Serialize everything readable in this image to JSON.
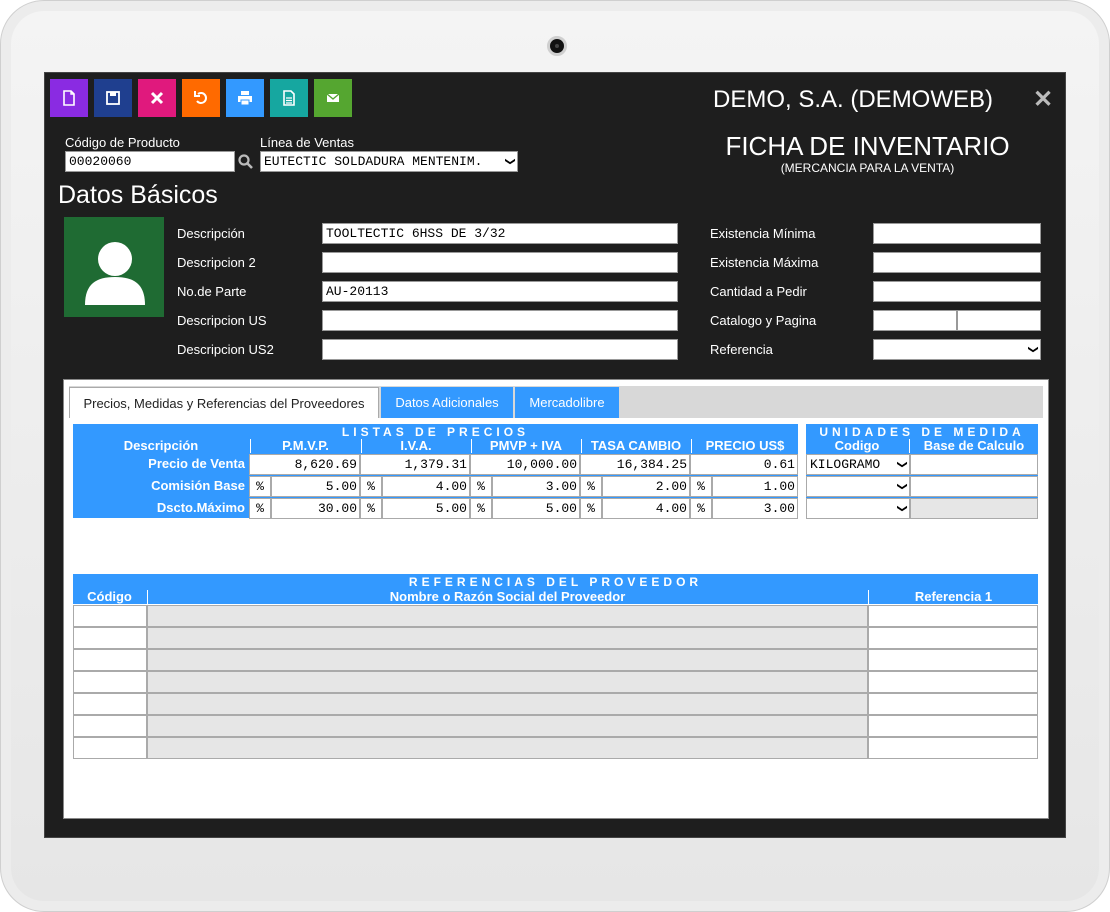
{
  "window": {
    "company": "DEMO, S.A. (DEMOWEB)",
    "title": "FICHA DE INVENTARIO",
    "subtitle": "(MERCANCIA PARA LA VENTA)"
  },
  "toolbar": [
    {
      "name": "new-button",
      "icon": "new-document-icon",
      "color": "#8a2be2"
    },
    {
      "name": "save-button",
      "icon": "floppy-disk-icon",
      "color": "#1f3f8f"
    },
    {
      "name": "delete-button",
      "icon": "x-icon",
      "color": "#e0197d"
    },
    {
      "name": "undo-button",
      "icon": "undo-icon",
      "color": "#ff6a00"
    },
    {
      "name": "print-button",
      "icon": "printer-icon",
      "color": "#3399ff"
    },
    {
      "name": "report-button",
      "icon": "document-icon",
      "color": "#16a7a0"
    },
    {
      "name": "email-button",
      "icon": "envelope-icon",
      "color": "#55a630"
    }
  ],
  "header": {
    "codigo_label": "Código de Producto",
    "codigo_value": "00020060",
    "linea_label": "Línea de Ventas",
    "linea_value": "EUTECTIC SOLDADURA MENTENIM."
  },
  "section_title": "Datos Básicos",
  "basic_fields_left": [
    {
      "label": "Descripción",
      "value": "TOOLTECTIC 6HSS DE 3/32"
    },
    {
      "label": "Descripcion 2",
      "value": ""
    },
    {
      "label": "No.de Parte",
      "value": "AU-20113"
    },
    {
      "label": "Descripcion US",
      "value": ""
    },
    {
      "label": "Descripcion US2",
      "value": ""
    }
  ],
  "basic_fields_right": [
    {
      "label": "Existencia Mínima",
      "value": ""
    },
    {
      "label": "Existencia Máxima",
      "value": ""
    },
    {
      "label": "Cantidad a Pedir",
      "value": ""
    },
    {
      "label": "Catalogo y Pagina",
      "value": ""
    },
    {
      "label": "Referencia",
      "value": ""
    }
  ],
  "tabs": [
    {
      "label": "Precios, Medidas y Referencias del Proveedores",
      "active": true
    },
    {
      "label": "Datos Adicionales",
      "active": false
    },
    {
      "label": "Mercadolibre",
      "active": false
    }
  ],
  "prices": {
    "title": "LISTAS DE PRECIOS",
    "columns": [
      "Descripción",
      "P.M.V.P.",
      "I.V.A.",
      "PMVP + IVA",
      "TASA CAMBIO",
      "PRECIO US$"
    ],
    "pct_symbol": "%",
    "rows": [
      {
        "label": "Precio de Venta",
        "values": [
          "8,620.69",
          "1,379.31",
          "10,000.00",
          "16,384.25",
          "0.61"
        ],
        "pct": false
      },
      {
        "label": "Comisión Base",
        "values": [
          "5.00",
          "4.00",
          "3.00",
          "2.00",
          "1.00"
        ],
        "pct": true
      },
      {
        "label": "Dscto.Máximo",
        "values": [
          "30.00",
          "5.00",
          "5.00",
          "4.00",
          "3.00"
        ],
        "pct": true
      }
    ]
  },
  "units": {
    "title": "UNIDADES DE MEDIDA",
    "col_codigo": "Codigo",
    "col_base": "Base de Calculo",
    "rows": [
      "KILOGRAMO",
      "",
      ""
    ]
  },
  "provider_refs": {
    "title": "REFERENCIAS DEL PROVEEDOR",
    "col_codigo": "Código",
    "col_nombre": "Nombre o Razón Social del Proveedor",
    "col_ref": "Referencia 1",
    "row_count": 7
  }
}
